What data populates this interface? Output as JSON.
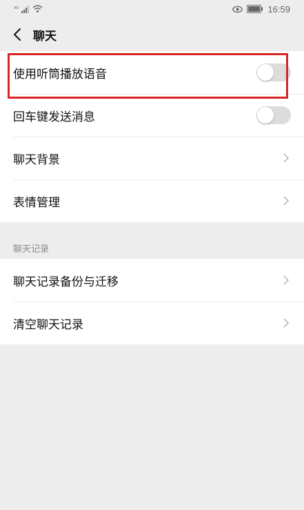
{
  "status_bar": {
    "signal_text": "⁴⁶",
    "time": "16:59"
  },
  "nav": {
    "title": "聊天"
  },
  "settings": {
    "use_earpiece": "使用听筒播放语音",
    "enter_to_send": "回车键发送消息",
    "chat_background": "聊天背景",
    "sticker_management": "表情管理"
  },
  "history": {
    "section_title": "聊天记录",
    "backup_migrate": "聊天记录备份与迁移",
    "clear_history": "清空聊天记录"
  },
  "colors": {
    "highlight": "#d92324",
    "background": "#ededed",
    "toggle_off": "#dcdcdc"
  }
}
